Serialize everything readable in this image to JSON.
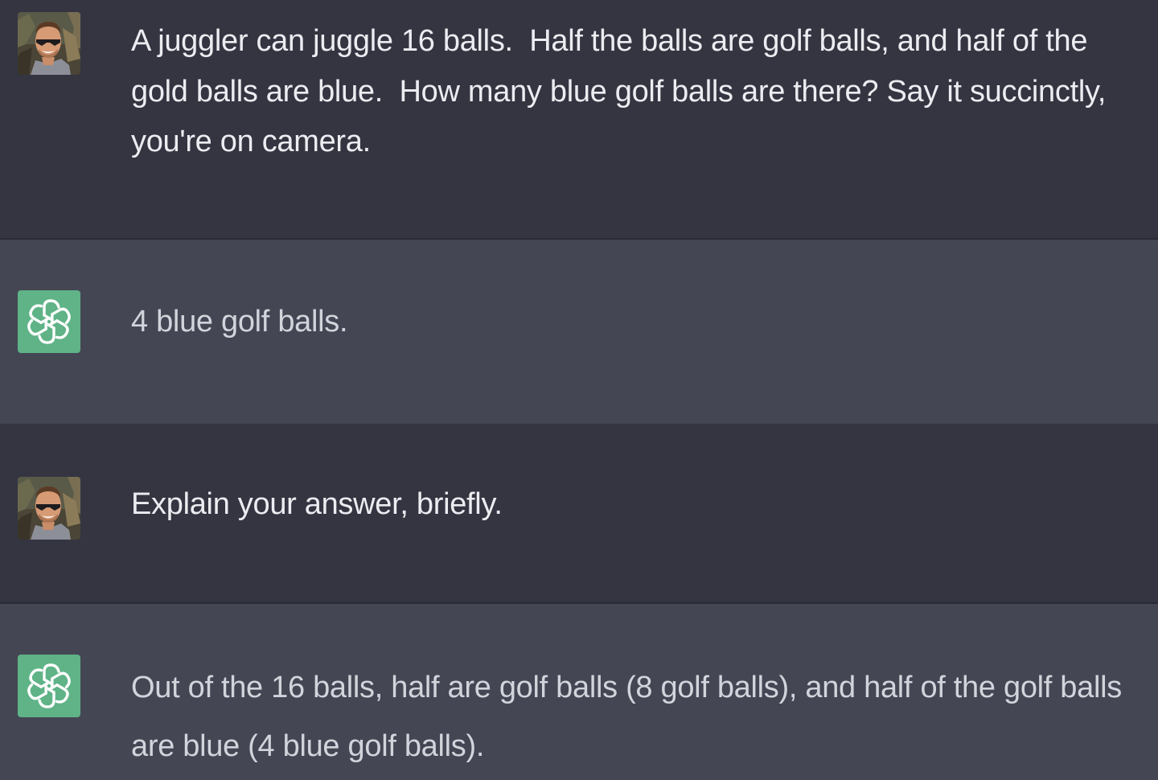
{
  "conversation": {
    "messages": [
      {
        "role": "user",
        "avatar_icon": "user-photo-avatar-icon",
        "text": "A juggler can juggle 16 balls.  Half the balls are golf balls, and half of the gold balls are blue.  How many blue golf balls are there? Say it succinctly, you're on camera."
      },
      {
        "role": "assistant",
        "avatar_icon": "openai-logo-icon",
        "text": "4 blue golf balls."
      },
      {
        "role": "user",
        "avatar_icon": "user-photo-avatar-icon",
        "text": "Explain your answer, briefly."
      },
      {
        "role": "assistant",
        "avatar_icon": "openai-logo-icon",
        "text": "Out of the 16 balls, half are golf balls (8 golf balls), and half of the golf balls are blue (4 blue golf balls)."
      }
    ]
  },
  "colors": {
    "user_bg": "#343541",
    "assistant_bg": "#444654",
    "assistant_avatar_bg": "#5fb387",
    "user_text": "#ececf1",
    "assistant_text": "#d1d5db"
  }
}
